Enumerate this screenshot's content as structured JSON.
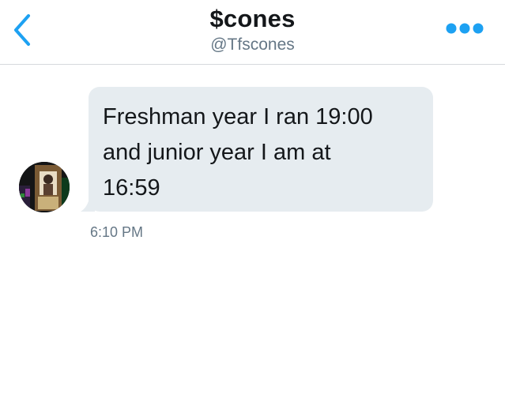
{
  "header": {
    "title": "$cones",
    "handle": "@Tfscones",
    "back_icon": "chevron-left-icon",
    "more_icon": "more-dots-icon",
    "accent_color": "#1da1f2"
  },
  "conversation": {
    "messages": [
      {
        "sender": "other",
        "text": "Freshman year I ran 19:00\nand junior year I am at\n16:59",
        "time": "6:10 PM",
        "bubble_color": "#e6ecf0"
      }
    ]
  }
}
